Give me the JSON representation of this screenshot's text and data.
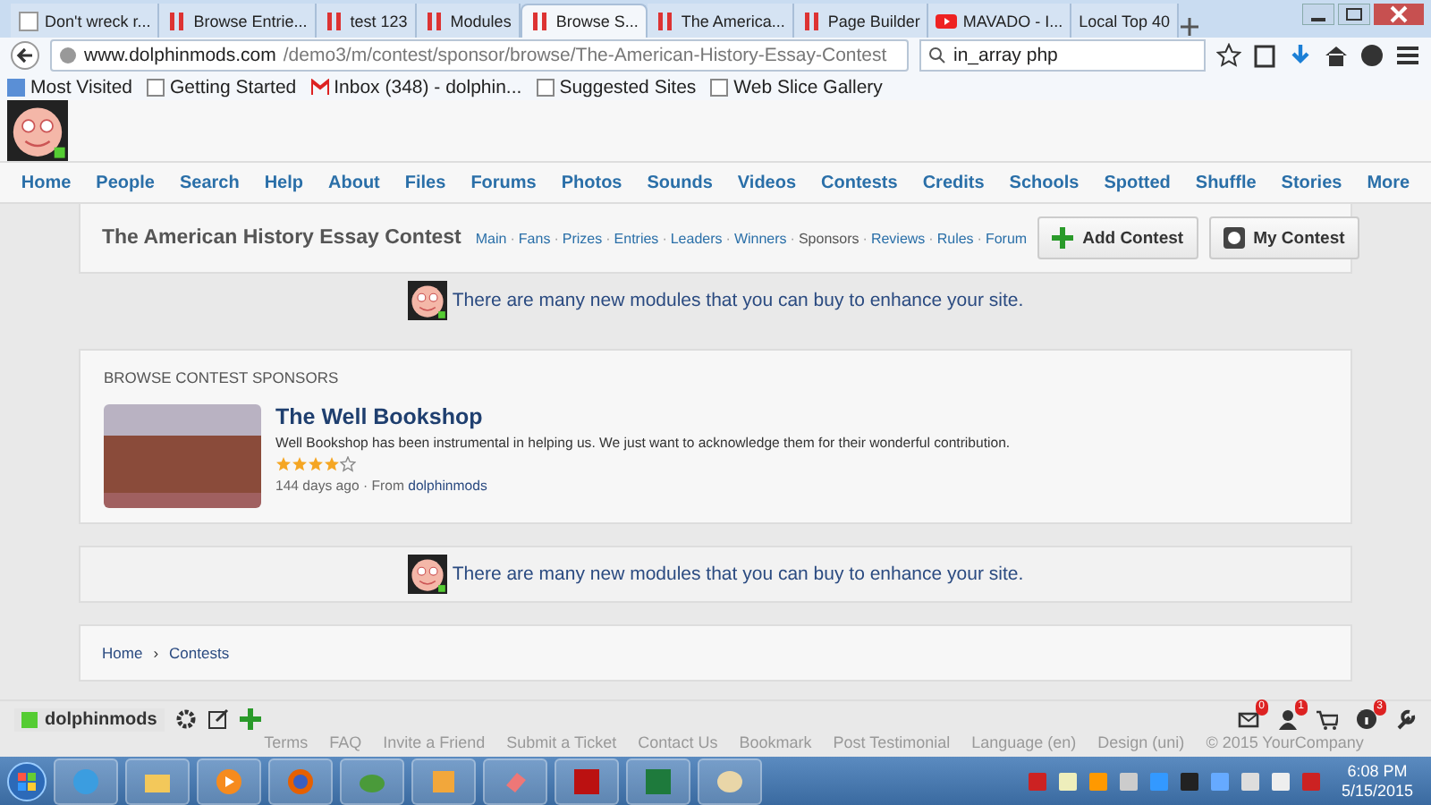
{
  "browser": {
    "tabs": [
      {
        "label": "Don't wreck r...",
        "selected": false,
        "kind": "blank"
      },
      {
        "label": "Browse Entrie...",
        "selected": false,
        "kind": "site"
      },
      {
        "label": "test 123",
        "selected": false,
        "kind": "site"
      },
      {
        "label": "Modules",
        "selected": false,
        "kind": "site"
      },
      {
        "label": "Browse S...",
        "selected": true,
        "kind": "site"
      },
      {
        "label": "The America...",
        "selected": false,
        "kind": "site"
      },
      {
        "label": "Page Builder",
        "selected": false,
        "kind": "site"
      },
      {
        "label": "MAVADO - I...",
        "selected": false,
        "kind": "video"
      },
      {
        "label": "Local Top 40",
        "selected": false,
        "kind": "none"
      }
    ],
    "url_domain": "www.dolphinmods.com",
    "url_path": "/demo3/m/contest/sponsor/browse/The-American-History-Essay-Contest",
    "search": {
      "value": "in_array php"
    },
    "bookmarks": [
      {
        "label": "Most Visited",
        "kind": "star"
      },
      {
        "label": "Getting Started",
        "kind": "page"
      },
      {
        "label": "Inbox (348) - dolphin...",
        "kind": "mail"
      },
      {
        "label": "Suggested Sites",
        "kind": "page"
      },
      {
        "label": "Web Slice Gallery",
        "kind": "page"
      }
    ]
  },
  "nav": [
    "Home",
    "People",
    "Search",
    "Help",
    "About",
    "Files",
    "Forums",
    "Photos",
    "Sounds",
    "Videos",
    "Contests",
    "Credits",
    "Schools",
    "Spotted",
    "Shuffle",
    "Stories",
    "More"
  ],
  "contest": {
    "title": "The American History Essay Contest",
    "links": [
      {
        "label": "Main",
        "selected": false
      },
      {
        "label": "Fans",
        "selected": false
      },
      {
        "label": "Prizes",
        "selected": false
      },
      {
        "label": "Entries",
        "selected": false
      },
      {
        "label": "Leaders",
        "selected": false
      },
      {
        "label": "Winners",
        "selected": false
      },
      {
        "label": "Sponsors",
        "selected": true
      },
      {
        "label": "Reviews",
        "selected": false
      },
      {
        "label": "Rules",
        "selected": false
      },
      {
        "label": "Forum",
        "selected": false
      }
    ],
    "separator": "·",
    "buttons": [
      {
        "label": "Add Contest",
        "kind": "add"
      },
      {
        "label": "My Contest",
        "kind": "contest"
      }
    ]
  },
  "notice_top": "There are many new modules that you can buy to enhance your site.",
  "sponsors": {
    "heading": "BROWSE CONTEST SPONSORS",
    "items": [
      {
        "name": "The Well Bookshop",
        "description": "Well Bookshop has been instrumental in helping us. We just want to acknowledge them for their wonderful contribution.",
        "stars": 4,
        "age": "144 days ago",
        "separator": "·",
        "from_label": "From",
        "author": "dolphinmods"
      }
    ]
  },
  "notice_bottom": "There are many new modules that you can buy to enhance your site.",
  "breadcrumb": {
    "items": [
      "Home",
      "Contests"
    ],
    "separator": "›"
  },
  "footer": {
    "links": [
      "Terms",
      "FAQ",
      "Invite a Friend",
      "Submit a Ticket",
      "Contact Us",
      "Bookmark",
      "Post Testimonial",
      "Language (en)",
      "Design (uni)"
    ],
    "copyright": "© 2015 YourCompany"
  },
  "toolbar": {
    "user": "dolphinmods",
    "notifications": [
      {
        "kind": "mail",
        "count": "0"
      },
      {
        "kind": "friends",
        "count": "1"
      },
      {
        "kind": "cart"
      },
      {
        "kind": "info",
        "count": "3"
      }
    ]
  },
  "taskbar": {
    "time": "6:08 PM",
    "date": "5/15/2015"
  }
}
